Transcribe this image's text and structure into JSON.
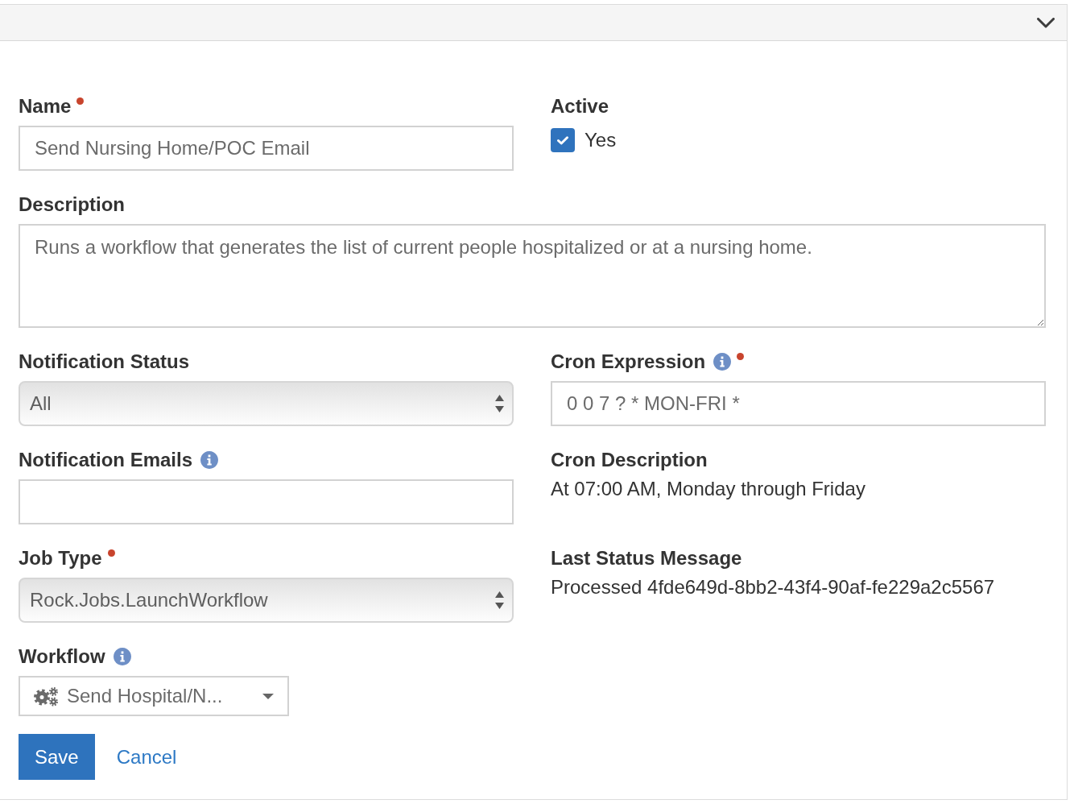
{
  "form": {
    "rows": [
      {
        "fields": [
          {
            "kind": "text",
            "label": "Name",
            "required": true,
            "info": false,
            "value": "Send Nursing Home/POC Email"
          },
          {
            "kind": "checkbox",
            "label": "Active",
            "required": false,
            "info": false,
            "option": "Yes",
            "checked": true
          }
        ]
      },
      {
        "fields": [
          {
            "kind": "textarea",
            "label": "Description",
            "required": false,
            "info": false,
            "value": "Runs a workflow that generates the list of current people hospitalized or at a nursing home."
          }
        ]
      },
      {
        "fields": [
          {
            "kind": "select",
            "label": "Notification Status",
            "required": false,
            "info": false,
            "value": "All"
          },
          {
            "kind": "text",
            "label": "Cron Expression",
            "required": true,
            "info": true,
            "value": "0 0 7 ? * MON-FRI *"
          }
        ]
      },
      {
        "fields": [
          {
            "kind": "text",
            "label": "Notification Emails",
            "required": false,
            "info": true
          },
          {
            "kind": "static",
            "label": "Cron Description",
            "required": false,
            "info": false,
            "value": "At 07:00 AM, Monday through Friday"
          }
        ]
      },
      {
        "fields": [
          {
            "kind": "select",
            "label": "Job Type",
            "required": true,
            "info": false,
            "value": "Rock.Jobs.LaunchWorkflow"
          },
          {
            "kind": "static",
            "label": "Last Status Message",
            "required": false,
            "info": false,
            "value": "Processed 4fde649d-8bb2-43f4-90af-fe229a2c5567"
          }
        ]
      },
      {
        "fields": [
          {
            "kind": "picker",
            "label": "Workflow",
            "required": false,
            "info": true,
            "value": "Send Hospital/N..."
          }
        ]
      }
    ]
  },
  "actions": [
    {
      "kind": "primary",
      "label": "Save"
    },
    {
      "kind": "link",
      "label": "Cancel"
    }
  ]
}
